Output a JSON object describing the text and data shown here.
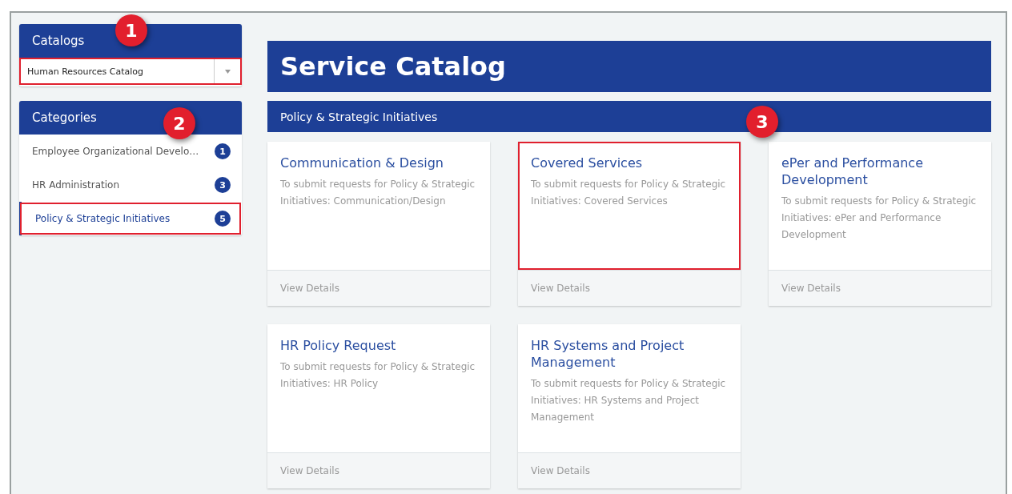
{
  "sidebar": {
    "catalogs": {
      "title": "Catalogs",
      "dropdown": {
        "value": "Human Resources Catalog",
        "highlighted": true
      }
    },
    "categories": {
      "title": "Categories",
      "items": [
        {
          "label": "Employee Organizational Develo…",
          "count": "1",
          "selected": false,
          "highlighted": false
        },
        {
          "label": "HR Administration",
          "count": "3",
          "selected": false,
          "highlighted": false
        },
        {
          "label": "Policy & Strategic Initiatives",
          "count": "5",
          "selected": true,
          "highlighted": true
        }
      ]
    }
  },
  "main": {
    "title": "Service Catalog",
    "section": "Policy & Strategic Initiatives",
    "cards": [
      {
        "title": "Communication & Design",
        "description": "To submit requests for Policy & Strategic Initiatives: Communication/Design",
        "link": "View Details",
        "highlighted": false
      },
      {
        "title": "Covered Services",
        "description": "To submit requests for Policy & Strategic Initiatives: Covered Services",
        "link": "View Details",
        "highlighted": true
      },
      {
        "title": "ePer and Performance Development",
        "description": "To submit requests for Policy & Strategic Initiatives: ePer and Performance Development",
        "link": "View Details",
        "highlighted": false
      },
      {
        "title": "HR Policy Request",
        "description": "To submit requests for Policy & Strategic Initiatives: HR Policy",
        "link": "View Details",
        "highlighted": false
      },
      {
        "title": "HR Systems and Project Management",
        "description": "To submit requests for Policy & Strategic Initiatives: HR Systems and Project Management",
        "link": "View Details",
        "highlighted": false
      }
    ]
  },
  "callouts": [
    {
      "label": "1"
    },
    {
      "label": "2"
    },
    {
      "label": "3"
    }
  ]
}
